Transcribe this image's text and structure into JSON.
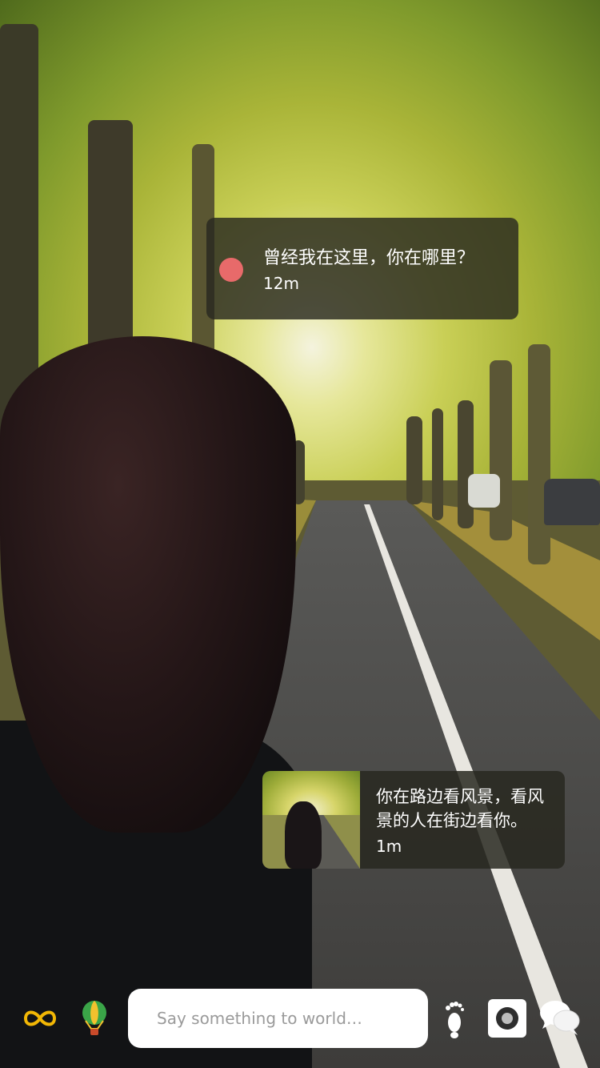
{
  "messages": [
    {
      "text": "曾经我在这里，你在哪里？",
      "distance": "12m"
    },
    {
      "text_line1": "你在路边看风景，看风",
      "text_line2": "景的人在街边看你。",
      "distance": "1m"
    }
  ],
  "toolbar": {
    "input_placeholder": "Say something to world…",
    "icons": [
      "infinity-icon",
      "balloon-icon",
      "footprint-icon",
      "camera-icon",
      "chat-bubbles-icon"
    ]
  },
  "colors": {
    "marker": "#e86a6a",
    "infinity": "#f2b705",
    "balloon_green": "#3aa548",
    "balloon_yellow": "#f2c12e"
  }
}
